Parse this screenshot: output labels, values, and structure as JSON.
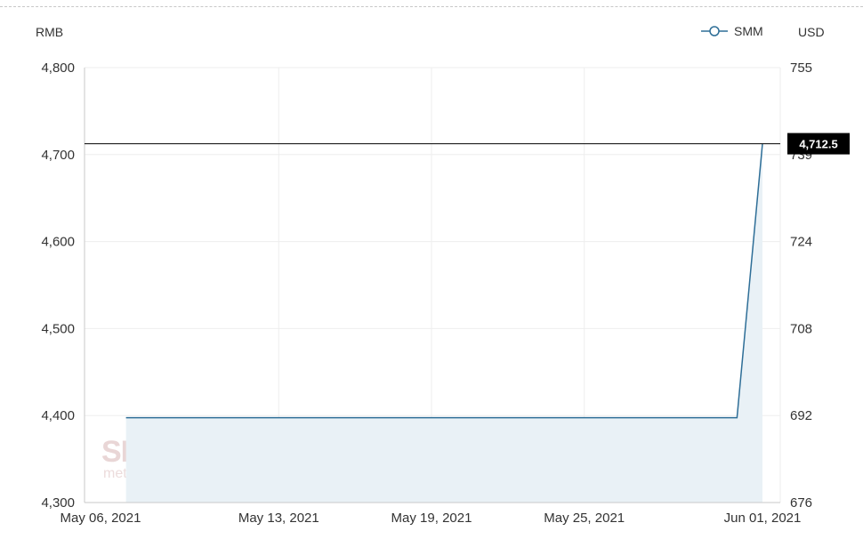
{
  "units": {
    "left": "RMB",
    "right": "USD"
  },
  "legend": {
    "label": "SMM"
  },
  "colors": {
    "line": "#2e6e97",
    "area": "#e9f1f6",
    "grid": "#eeeeee",
    "axis": "#c9c9c9",
    "marker_line": "#000000",
    "tag_bg": "#000000"
  },
  "current": {
    "label": "4,712.5",
    "value": 4712.5
  },
  "watermark": {
    "big": "SMM",
    "small": "metal.com"
  },
  "chart_data": {
    "type": "area",
    "series": [
      {
        "name": "SMM",
        "x": [
          "2021-05-07",
          "2021-05-31",
          "2021-06-01"
        ],
        "values": [
          4397.5,
          4397.5,
          4712.5
        ]
      }
    ],
    "x_ticks": [
      {
        "date": "2021-05-06",
        "label": "May 06, 2021"
      },
      {
        "date": "2021-05-13",
        "label": "May 13, 2021"
      },
      {
        "date": "2021-05-19",
        "label": "May 19, 2021"
      },
      {
        "date": "2021-05-25",
        "label": "May 25, 2021"
      },
      {
        "date": "2021-06-01",
        "label": "Jun 01, 2021"
      }
    ],
    "xlim": [
      "2021-05-06",
      "2021-06-01"
    ],
    "ylim": [
      4300,
      4800
    ],
    "y_left_ticks": [
      {
        "value": 4300,
        "label": "4,300"
      },
      {
        "value": 4400,
        "label": "4,400"
      },
      {
        "value": 4500,
        "label": "4,500"
      },
      {
        "value": 4600,
        "label": "4,600"
      },
      {
        "value": 4700,
        "label": "4,700"
      },
      {
        "value": 4800,
        "label": "4,800"
      }
    ],
    "y_right_ticks": [
      {
        "value": 4300,
        "label": "676"
      },
      {
        "value": 4400,
        "label": "692"
      },
      {
        "value": 4500,
        "label": "708"
      },
      {
        "value": 4600,
        "label": "724"
      },
      {
        "value": 4700,
        "label": "739"
      },
      {
        "value": 4800,
        "label": "755"
      }
    ],
    "ylabel_left": "RMB",
    "ylabel_right": "USD",
    "grid": true,
    "legend_position": "top-right"
  }
}
